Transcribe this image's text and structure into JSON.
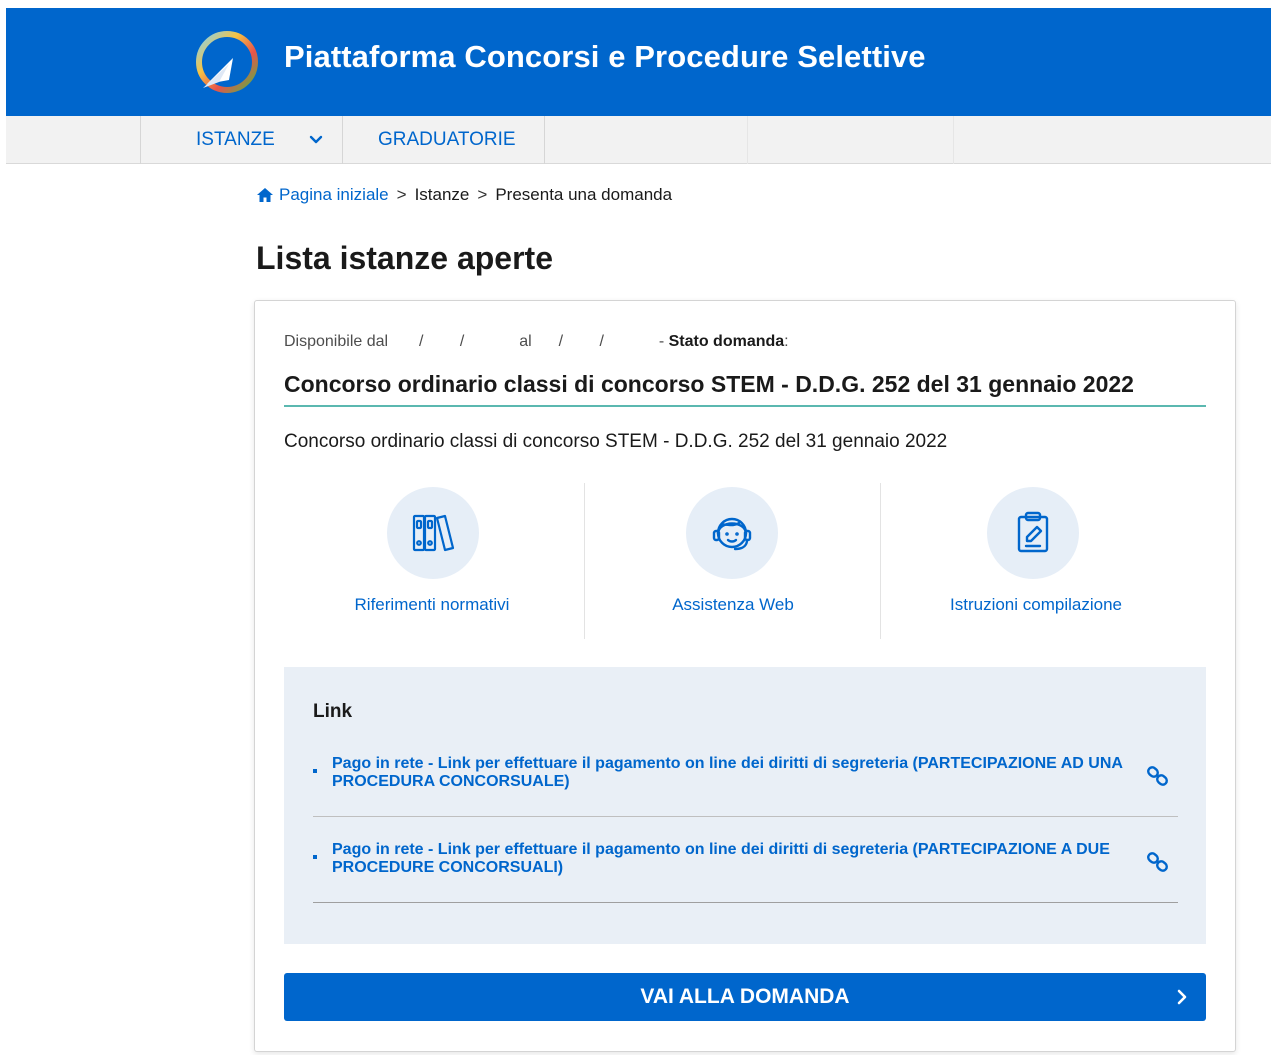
{
  "header": {
    "title": "Piattaforma Concorsi e Procedure Selettive",
    "logo_icon": "platform-logo-icon",
    "background": "#0066cc"
  },
  "nav": {
    "items": [
      {
        "label": "ISTANZE",
        "has_dropdown": true
      },
      {
        "label": "GRADUATORIE",
        "has_dropdown": false
      }
    ]
  },
  "breadcrumb": {
    "home": "Pagina iniziale",
    "sep": ">",
    "items": [
      "Istanze",
      "Presenta una domanda"
    ]
  },
  "page_title": "Lista istanze aperte",
  "card": {
    "availability": {
      "from_label": "Disponibile dal",
      "from_value": "/ /",
      "to_label": "al",
      "to_value": "/ /",
      "state_prefix": "-",
      "state_label": "Stato domanda",
      "state_colon": ":"
    },
    "title": "Concorso ordinario classi di concorso STEM - D.D.G. 252 del 31 gennaio 2022",
    "description": "Concorso ordinario classi di concorso STEM - D.D.G. 252 del 31 gennaio 2022",
    "features": [
      {
        "label": "Riferimenti normativi",
        "icon": "binders-icon"
      },
      {
        "label": "Assistenza Web",
        "icon": "headset-support-icon"
      },
      {
        "label": "Istruzioni compilazione",
        "icon": "clipboard-edit-icon"
      }
    ],
    "links": {
      "heading": "Link",
      "items": [
        {
          "text": "Pago in rete - Link per effettuare il pagamento on line dei diritti di segreteria (PARTECIPAZIONE AD UNA PROCEDURA CONCORSUALE)",
          "icon": "chain-link-icon"
        },
        {
          "text": "Pago in rete - Link per effettuare il pagamento on line dei diritti di segreteria (PARTECIPAZIONE A DUE PROCEDURE CONCORSUALI)",
          "icon": "chain-link-icon"
        }
      ]
    },
    "cta_label": "VAI ALLA DOMANDA"
  },
  "colors": {
    "primary": "#0066cc",
    "accent_underline": "#5bb8b0",
    "link_box_bg": "#e9eff6",
    "icon_circle_bg": "#e6eef7"
  }
}
